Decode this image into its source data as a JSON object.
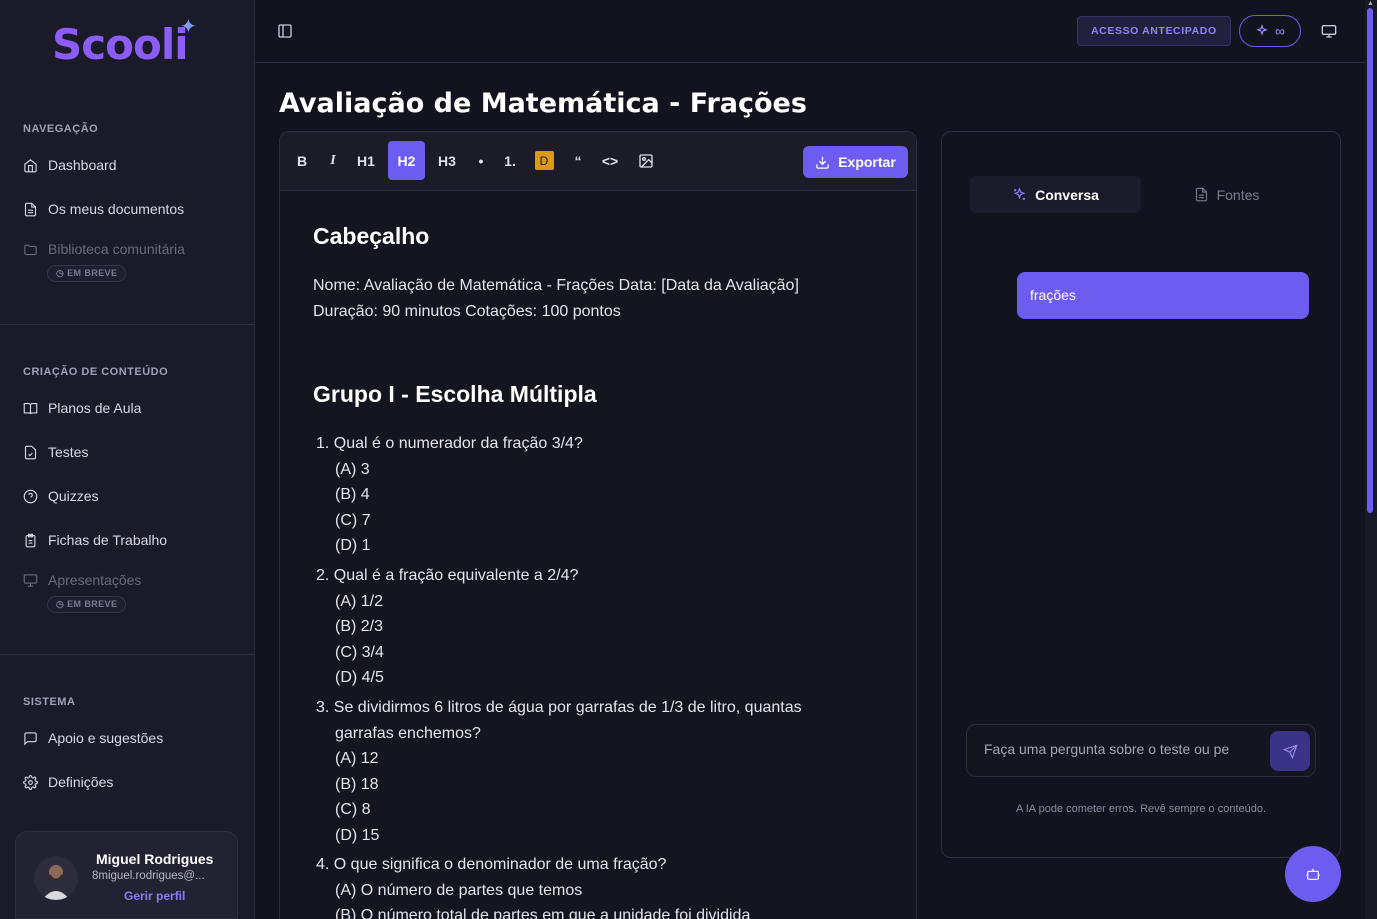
{
  "brand": {
    "logo_text": "Scooli"
  },
  "sidebar": {
    "sections": [
      {
        "title": "NAVEGAÇÃO"
      },
      {
        "title": "CRIAÇÃO DE CONTEÚDO"
      },
      {
        "title": "SISTEMA"
      }
    ],
    "items": [
      {
        "label": "Dashboard",
        "icon": "home-icon"
      },
      {
        "label": "Os meus documentos",
        "icon": "document-icon"
      },
      {
        "label": "Biblioteca comunitária",
        "icon": "folder-icon",
        "badge": "EM BREVE"
      },
      {
        "label": "Planos de Aula",
        "icon": "book-icon"
      },
      {
        "label": "Testes",
        "icon": "test-file-icon"
      },
      {
        "label": "Quizzes",
        "icon": "help-circle-icon"
      },
      {
        "label": "Fichas de Trabalho",
        "icon": "clipboard-icon"
      },
      {
        "label": "Apresentações",
        "icon": "presentation-icon",
        "badge": "EM BREVE"
      },
      {
        "label": "Apoio e sugestões",
        "icon": "message-icon"
      },
      {
        "label": "Definições",
        "icon": "gear-icon"
      }
    ],
    "profile": {
      "name": "Miguel Rodrigues",
      "email": "8miguel.rodrigues@...",
      "link": "Gerir perfil"
    }
  },
  "topbar": {
    "early_access": "ACESSO ANTECIPADO",
    "credits": "∞"
  },
  "document": {
    "title": "Avaliação de Matemática - Frações",
    "toolbar": {
      "bold": "B",
      "italic": "I",
      "h1": "H1",
      "h2": "H2",
      "h3": "H3",
      "bullet": "•",
      "numbered": "1.",
      "highlight": "D",
      "quote": "“",
      "code": "<>",
      "export": "Exportar"
    },
    "header_title": "Cabeçalho",
    "header_line1": "Nome: Avaliação de Matemática - Frações Data: [Data da Avaliação]",
    "header_line2": "Duração: 90 minutos Cotações: 100 pontos",
    "group_title": "Grupo I - Escolha Múltipla",
    "questions": [
      {
        "text": "1. Qual é o numerador da fração 3/4?",
        "options": [
          "(A) 3",
          "(B) 4",
          "(C) 7",
          "(D) 1"
        ]
      },
      {
        "text": "2. Qual é a fração equivalente a 2/4?",
        "options": [
          "(A) 1/2",
          "(B) 2/3",
          "(C) 3/4",
          "(D) 4/5"
        ]
      },
      {
        "text_line1": "3. Se dividirmos 6 litros de água por garrafas de 1/3 de litro, quantas",
        "text_line2": "garrafas enchemos?",
        "options": [
          "(A) 12",
          "(B) 18",
          "(C) 8",
          "(D) 15"
        ]
      },
      {
        "text": "4. O que significa o denominador de uma fração?",
        "options": [
          "(A) O número de partes que temos",
          "(B) O número total de partes em que a unidade foi dividida"
        ]
      }
    ]
  },
  "chat": {
    "tabs": [
      {
        "label": "Conversa",
        "active": true
      },
      {
        "label": "Fontes",
        "active": false
      }
    ],
    "messages": [
      {
        "role": "user",
        "text": "frações"
      }
    ],
    "input_placeholder": "Faça uma pergunta sobre o teste ou pe",
    "disclaimer": "A IA pode cometer erros. Revê sempre o conteúdo."
  },
  "colors": {
    "accent": "#6d5cf0",
    "background": "#13131f",
    "sidebar": "#1a1a29",
    "highlight": "#d99a1a"
  }
}
